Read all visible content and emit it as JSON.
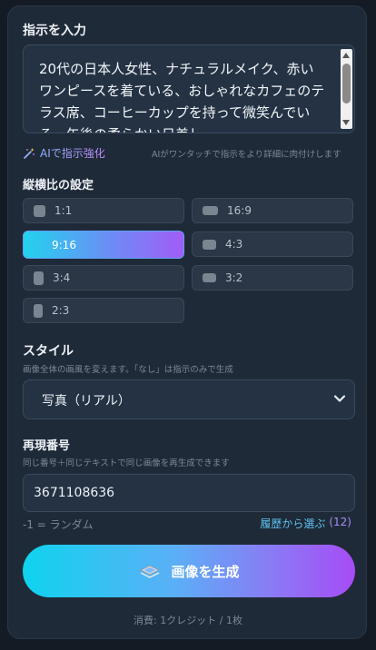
{
  "prompt": {
    "title": "指示を入力",
    "text": "20代の日本人女性、ナチュラルメイク、赤いワンピースを着ている、おしゃれなカフェのテラス席、コーヒーカップを持って微笑んでいる、午後の柔らかい日差し"
  },
  "enhance": {
    "label": "AIで指示強化",
    "hint": "AIがワンタッチで指示をより詳細に肉付けします",
    "icon": "magic-wand-icon"
  },
  "aspect": {
    "title": "縦横比の設定",
    "options": [
      {
        "label": "1:1",
        "active": false
      },
      {
        "label": "16:9",
        "active": false
      },
      {
        "label": "9:16",
        "active": true
      },
      {
        "label": "4:3",
        "active": false
      },
      {
        "label": "3:4",
        "active": false
      },
      {
        "label": "3:2",
        "active": false
      },
      {
        "label": "2:3",
        "active": false
      }
    ]
  },
  "style": {
    "title": "スタイル",
    "hint": "画像全体の画風を変えます。「なし」は指示のみで生成",
    "selected": "写真（リアル）"
  },
  "seed": {
    "title": "再現番号",
    "hint": "同じ番号＋同じテキストで同じ画像を再生成できます",
    "value": "3671108636",
    "random_note": "-1 = ランダム",
    "history_label": "履歴から選ぶ",
    "history_count": "(12)"
  },
  "generate": {
    "label": "画像を生成",
    "icon": "image-stack-icon"
  },
  "footer": {
    "cost": "消費: 1クレジット / 1枚"
  },
  "colors": {
    "background": "#141b24",
    "panel": "#1f2a38",
    "accent_start": "#22d3ee",
    "accent_end": "#a855f7",
    "link": "#8fb3ff"
  }
}
